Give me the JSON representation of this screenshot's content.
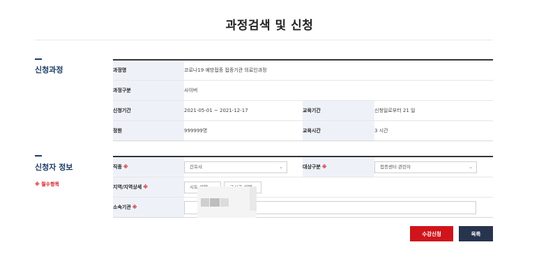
{
  "page_title": "과정검색 및 신청",
  "course_section": {
    "title": "신청과정",
    "rows": {
      "course_name_label": "과정명",
      "course_name_value": "코로나19 예방접종 접종기관 의료인과정",
      "course_type_label": "과정구분",
      "course_type_value": "사이버",
      "apply_period_label": "신청기간",
      "apply_period_value": "2021-05-01 ~ 2021-12-17",
      "edu_period_label": "교육기간",
      "edu_period_value": "신청일로부터 21 일",
      "capacity_label": "정원",
      "capacity_value": "999999명",
      "edu_hours_label": "교육시간",
      "edu_hours_value": "3 시간"
    }
  },
  "applicant_section": {
    "title": "신청자 정보",
    "required_note": "※ 필수항목",
    "required_mark": "※",
    "job_label": "직종",
    "job_value": "간호사",
    "target_label": "대상구분",
    "target_value": "접종센터 관련자",
    "region_label": "지역/지역상세",
    "region_sido": "시도 선택",
    "region_sigungu": "구시군 선택",
    "org_label": "소속기관",
    "org_value": ""
  },
  "buttons": {
    "apply": "수강신청",
    "list": "목록"
  },
  "icons": {
    "dropdown_arrow": "chevron-down-icon"
  },
  "colors": {
    "primary_navy": "#1d3b66",
    "required_red": "#d0141b",
    "apply_button": "#d0141b",
    "list_button": "#27344d",
    "header_cell_bg": "#eef2f8"
  }
}
